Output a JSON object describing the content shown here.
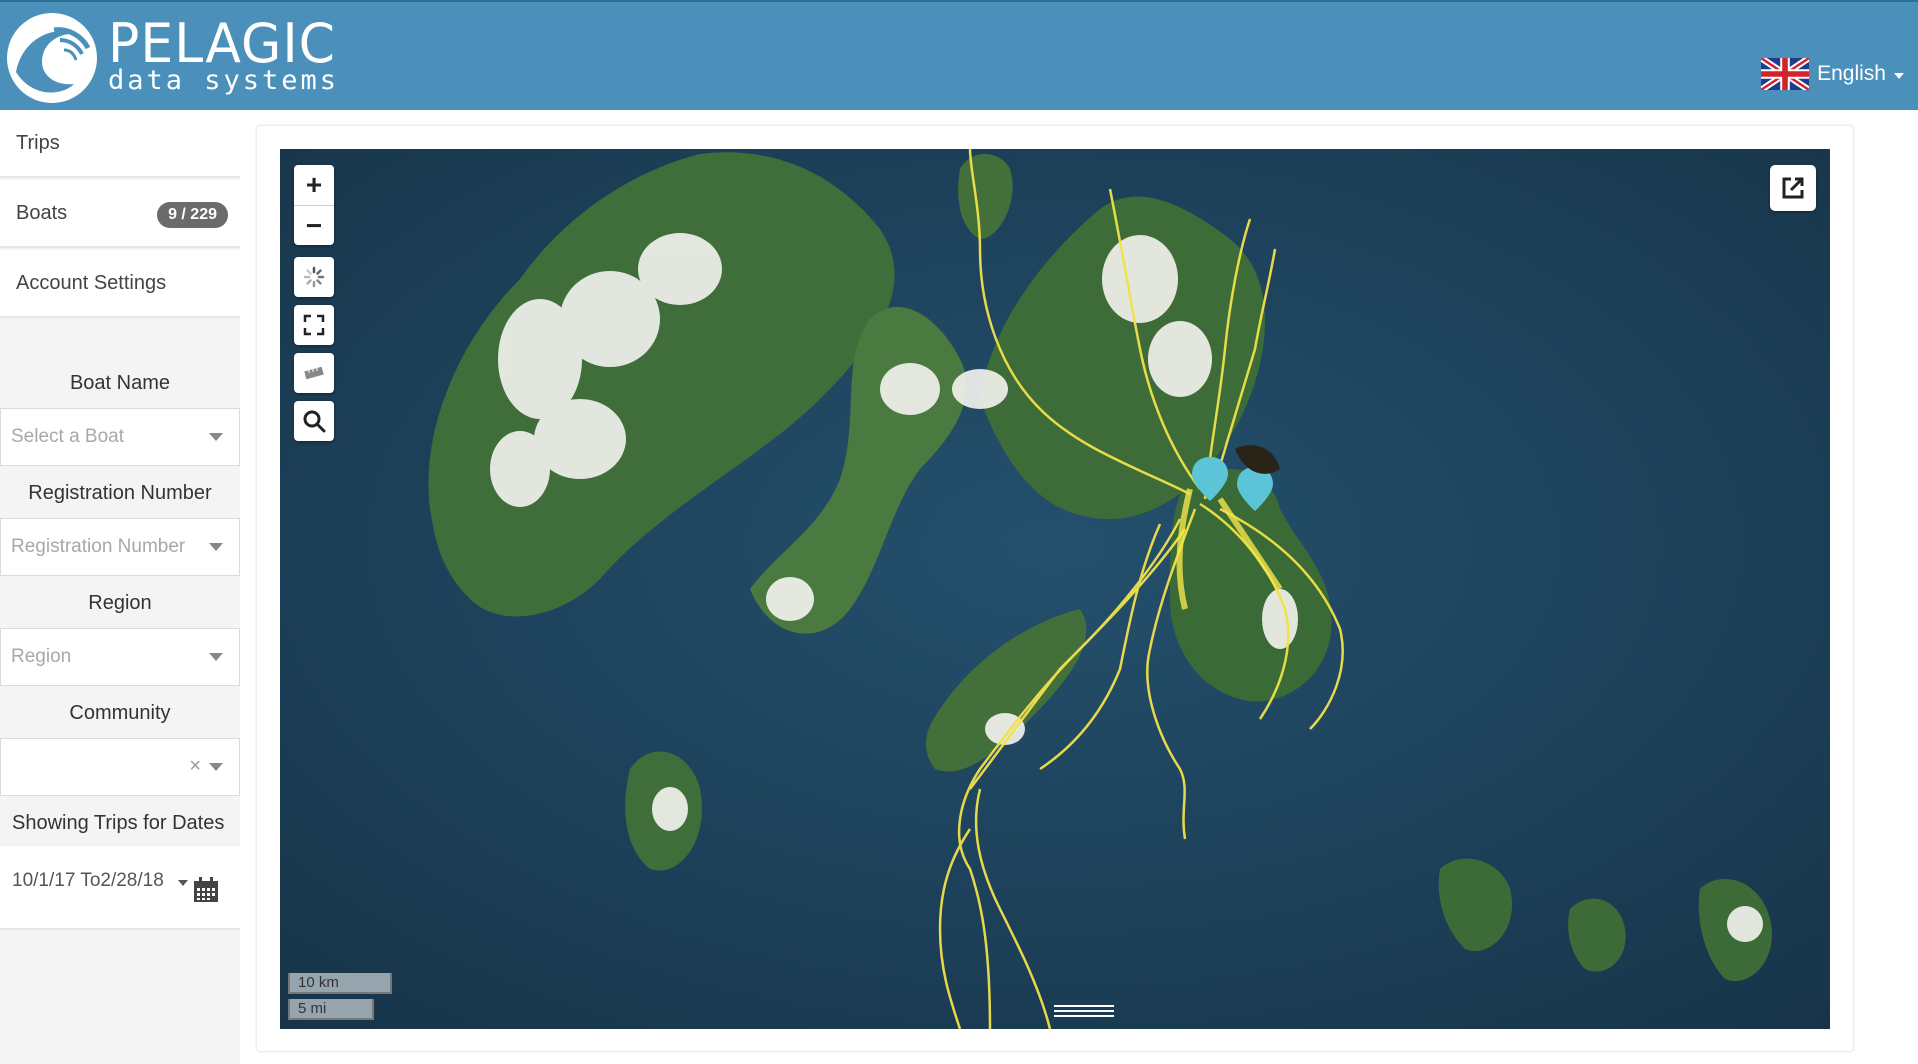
{
  "header": {
    "brand_title": "PELAGIC",
    "brand_subtitle": "data systems",
    "language": "English",
    "icons": {
      "logo": "wave-logo",
      "flag": "uk-flag-icon"
    }
  },
  "sidebar": {
    "nav": [
      {
        "label": "Trips"
      },
      {
        "label": "Boats",
        "badge": "9 / 229"
      },
      {
        "label": "Account Settings"
      }
    ],
    "filters": {
      "boat_name_label": "Boat Name",
      "boat_name_placeholder": "Select a Boat",
      "registration_label": "Registration Number",
      "registration_placeholder": "Registration Number",
      "region_label": "Region",
      "region_placeholder": "Region",
      "community_label": "Community",
      "community_value": "",
      "community_clear": "×",
      "dates_label": "Showing Trips for Dates",
      "dates_value": "10/1/17 To2/28/18"
    }
  },
  "map": {
    "controls": {
      "zoom_in": "+",
      "zoom_out": "−",
      "icons": [
        "loading-icon",
        "fullscreen-icon",
        "ruler-icon",
        "search-icon",
        "external-link-icon"
      ]
    },
    "scale_km": "10 km",
    "scale_mi": "5 mi",
    "colors": {
      "sea": "#1e4360",
      "land": "#3f6e3a",
      "cloud": "#f2f2ee",
      "track": "#f2e14a",
      "marker": "#5bc4d6"
    }
  }
}
